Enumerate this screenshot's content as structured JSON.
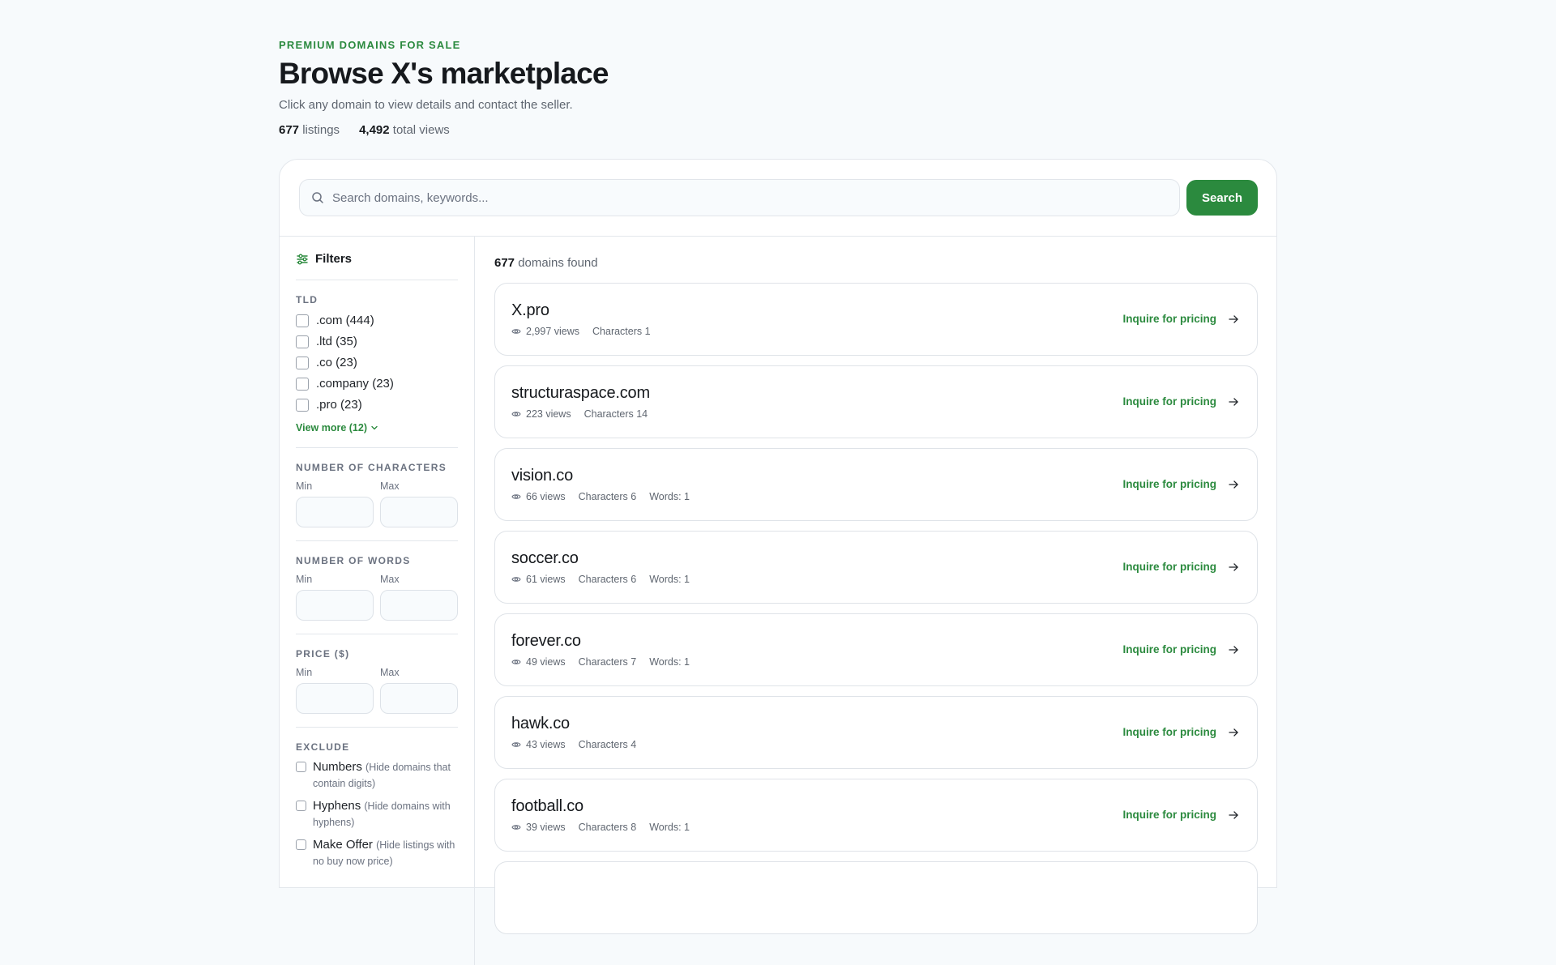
{
  "header": {
    "eyebrow": "PREMIUM DOMAINS FOR SALE",
    "title": "Browse X's marketplace",
    "subtitle": "Click any domain to view details and contact the seller.",
    "listings_count": "677",
    "listings_label": "listings",
    "views_count": "4,492",
    "views_label": "total views"
  },
  "search": {
    "placeholder": "Search domains, keywords...",
    "value": "",
    "button_label": "Search"
  },
  "filters": {
    "title": "Filters",
    "tld": {
      "title": "TLD",
      "items": [
        {
          "label": ".com (444)",
          "checked": false
        },
        {
          "label": ".ltd (35)",
          "checked": false
        },
        {
          "label": ".co (23)",
          "checked": false
        },
        {
          "label": ".company (23)",
          "checked": false
        },
        {
          "label": ".pro (23)",
          "checked": false
        }
      ],
      "view_more": "View more (12)"
    },
    "characters": {
      "title": "NUMBER OF CHARACTERS",
      "min_label": "Min",
      "max_label": "Max"
    },
    "words": {
      "title": "NUMBER OF WORDS",
      "min_label": "Min",
      "max_label": "Max"
    },
    "price": {
      "title": "PRICE ($)",
      "min_label": "Min",
      "max_label": "Max"
    },
    "exclude": {
      "title": "EXCLUDE",
      "items": [
        {
          "label": "Numbers",
          "hint": "(Hide domains that contain digits)"
        },
        {
          "label": "Hyphens",
          "hint": "(Hide domains with hyphens)"
        },
        {
          "label": "Make Offer",
          "hint": "(Hide listings with no buy now price)"
        }
      ]
    }
  },
  "results": {
    "count": "677",
    "count_label": "domains found",
    "cta_label": "Inquire for pricing",
    "items": [
      {
        "name": "X.pro",
        "views": "2,997 views",
        "characters": "Characters 1",
        "words": ""
      },
      {
        "name": "structuraspace.com",
        "views": "223 views",
        "characters": "Characters 14",
        "words": ""
      },
      {
        "name": "vision.co",
        "views": "66 views",
        "characters": "Characters 6",
        "words": "Words: 1"
      },
      {
        "name": "soccer.co",
        "views": "61 views",
        "characters": "Characters 6",
        "words": "Words: 1"
      },
      {
        "name": "forever.co",
        "views": "49 views",
        "characters": "Characters 7",
        "words": "Words: 1"
      },
      {
        "name": "hawk.co",
        "views": "43 views",
        "characters": "Characters 4",
        "words": ""
      },
      {
        "name": "football.co",
        "views": "39 views",
        "characters": "Characters 8",
        "words": "Words: 1"
      }
    ]
  },
  "colors": {
    "accent": "#2b8a3e",
    "background": "#f7fafc",
    "text": "#16191d"
  }
}
